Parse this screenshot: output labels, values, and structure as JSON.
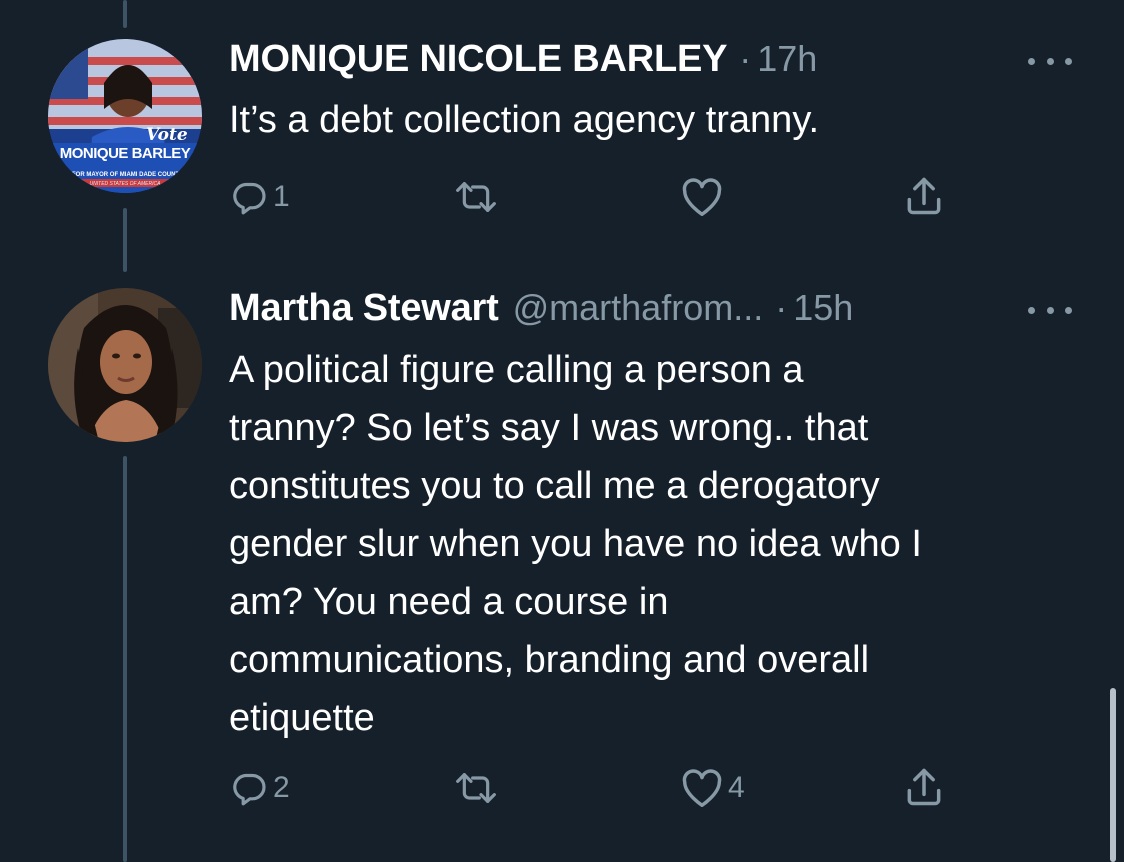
{
  "tweets": [
    {
      "name": "MONIQUE NICOLE BARLEY",
      "handle": "",
      "separator": "·",
      "time": "17h",
      "text": "It’s a debt collection agency tranny.",
      "avatar": {
        "vote_text": "Vote",
        "name_text": "MONIQUE BARLEY",
        "subtitle_text": "FOR MAYOR OF MIAMI DADE COUNTY",
        "footer_text": "UNITED STATES OF AMERICA"
      },
      "actions": {
        "reply_count": "1",
        "retweet_count": "",
        "like_count": ""
      }
    },
    {
      "name": "Martha Stewart",
      "handle": "@marthafrom...",
      "separator": "·",
      "time": "15h",
      "text": "A political figure calling a person a\ntranny? So let’s say I was wrong.. that\nconstitutes you to call me a derogatory\ngender slur when you have no idea who I\nam? You need a course in\ncommunications, branding and overall\netiquette",
      "actions": {
        "reply_count": "2",
        "retweet_count": "",
        "like_count": "4"
      }
    }
  ],
  "icons": {
    "reply": "reply-icon",
    "retweet": "retweet-icon",
    "like": "heart-icon",
    "share": "share-icon",
    "more": "more-icon"
  },
  "colors": {
    "background": "#15202b",
    "text": "#ffffff",
    "secondary": "#8899a6",
    "thread_line": "#3d5466"
  }
}
